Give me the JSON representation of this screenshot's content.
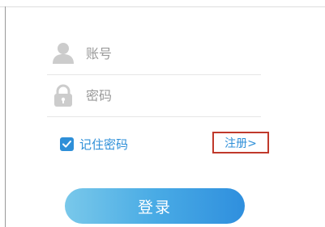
{
  "form": {
    "account": {
      "value": "",
      "placeholder": "账号",
      "icon": "user-icon"
    },
    "password": {
      "value": "",
      "placeholder": "密码",
      "icon": "lock-icon"
    },
    "remember": {
      "label": "记住密码",
      "checked": true
    },
    "register_label": "注册>",
    "login_label": "登录"
  },
  "colors": {
    "accent": "#2e8fd8",
    "icon": "#cccccc",
    "highlight_border": "#c0392b",
    "button_gradient_start": "#79c8ea",
    "button_gradient_end": "#2f8fde"
  }
}
